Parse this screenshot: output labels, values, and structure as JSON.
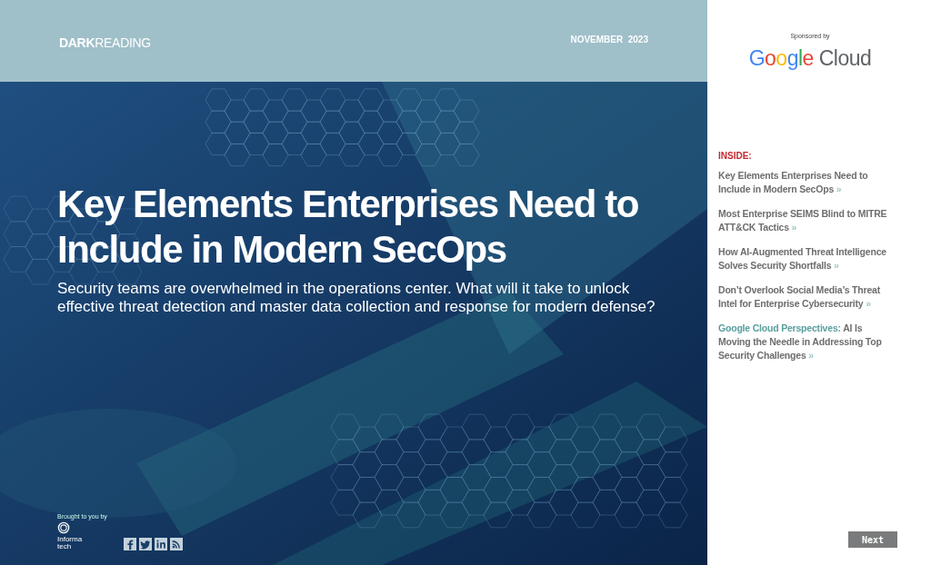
{
  "header": {
    "logo": "**DARK**READING",
    "date": "NOVEMBER  2023"
  },
  "hero": {
    "kind": "picture",
    "title": "Key Elements Enterprises Need to Include in Modern SecOps",
    "subtitle": "Security teams are overwhelmed in the operations center. What will it take to unlock effective threat detection and master data collection and response for modern defense?"
  },
  "footer": {
    "credit": "Brought to you by",
    "publisher": "Informa tech",
    "social": [
      {
        "kind": "facebook"
      },
      {
        "kind": "twitter"
      },
      {
        "kind": "linkedin"
      },
      {
        "kind": "rss"
      }
    ]
  },
  "sponsor": {
    "label": "Sponsored by",
    "brand": "Google",
    "product": "Cloud"
  },
  "inside": {
    "heading": "INSIDE:",
    "items": [
      {
        "text": "Key Elements Enterprises Need to Include in Modern SecOps",
        "arrow": "»"
      },
      {
        "text": "Most Enterprise SEIMS Blind to MITRE ATT&CK Tactics",
        "arrow": "»"
      },
      {
        "text": "How AI-Augmented Threat Intelligence Solves Security Shortfalls",
        "arrow": "»"
      },
      {
        "text": "Don’t Overlook Social Media’s Threat Intel for Enterprise Cybersecurity",
        "arrow": "»"
      },
      {
        "lead": "Google Cloud Perspectives:",
        "text": "AI Is Moving the Needle in Addressing Top Security Challenges",
        "arrow": "»"
      }
    ]
  },
  "next_button": "Next"
}
